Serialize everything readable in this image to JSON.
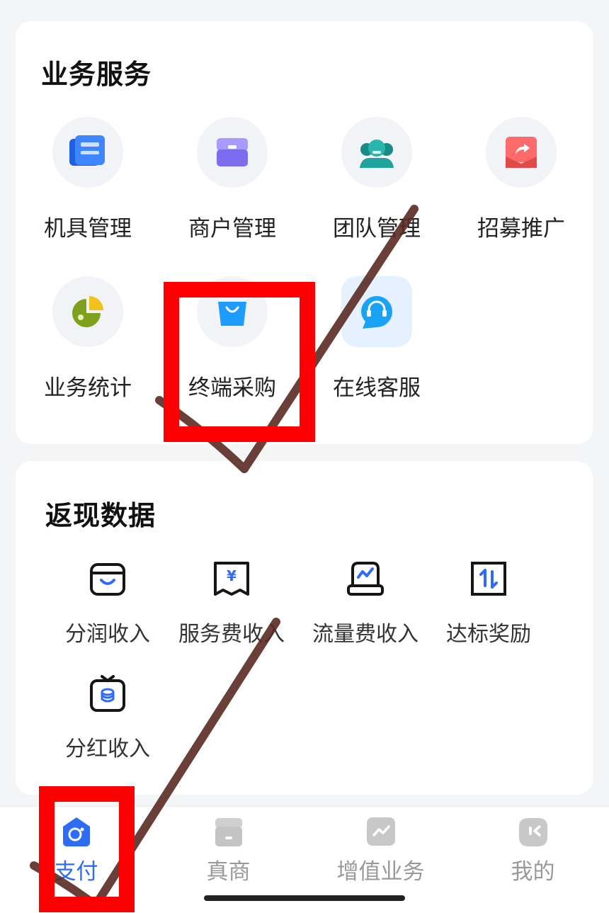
{
  "business_services": {
    "title": "业务服务",
    "items": [
      {
        "label": "机具管理",
        "icon": "device-card-icon"
      },
      {
        "label": "商户管理",
        "icon": "merchant-box-icon"
      },
      {
        "label": "团队管理",
        "icon": "team-people-icon"
      },
      {
        "label": "招募推广",
        "icon": "share-envelope-icon"
      },
      {
        "label": "业务统计",
        "icon": "pie-chart-icon"
      },
      {
        "label": "终端采购",
        "icon": "shopping-bag-icon"
      },
      {
        "label": "在线客服",
        "icon": "headset-chat-icon"
      }
    ]
  },
  "cashback_data": {
    "title": "返现数据",
    "items": [
      {
        "label": "分润收入",
        "icon": "basket-icon"
      },
      {
        "label": "服务费收入",
        "icon": "yen-receipt-icon"
      },
      {
        "label": "流量费收入",
        "icon": "traffic-device-icon"
      },
      {
        "label": "达标奖励",
        "icon": "exchange-arrows-icon"
      },
      {
        "label": "分红收入",
        "icon": "coin-box-icon"
      }
    ]
  },
  "tabbar": {
    "tabs": [
      {
        "label": "支付",
        "active": true
      },
      {
        "label": "真商",
        "active": false
      },
      {
        "label": "增值业务",
        "active": false
      },
      {
        "label": "我的",
        "active": false
      }
    ]
  },
  "colors": {
    "accent": "#2f6cf6",
    "annotation": "#ff0000",
    "inactive_tab": "#999999"
  }
}
